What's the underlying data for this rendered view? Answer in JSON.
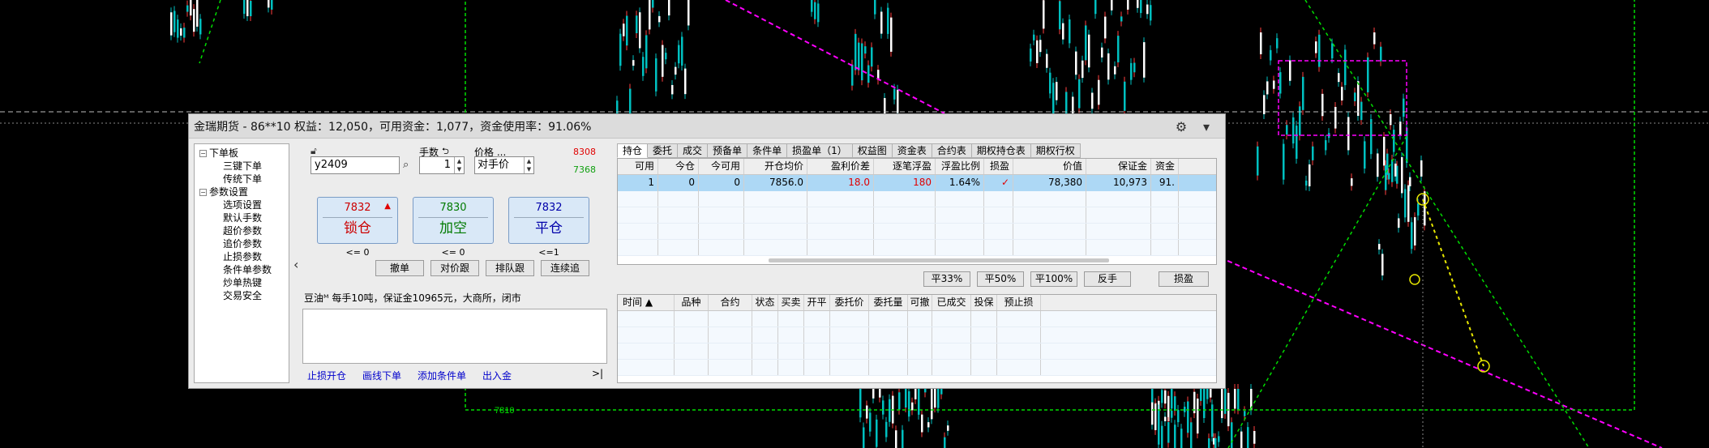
{
  "window": {
    "title": "金瑞期货 - 86**10  权益：12,050，可用资金：1,077，资金使用率：91.06%"
  },
  "tree": {
    "groups": [
      {
        "label": "下单板",
        "items": [
          "三键下单",
          "传统下单"
        ]
      },
      {
        "label": "参数设置",
        "items": [
          "选项设置",
          "默认手数",
          "超价参数",
          "追价参数",
          "止损参数",
          "条件单参数",
          "炒单热键",
          "交易安全"
        ]
      }
    ]
  },
  "order": {
    "contract_value": "y2409",
    "qty_label": "手数",
    "qty_value": "1",
    "price_label": "价格 ...",
    "price_type": "对手价",
    "ask_price": "8308",
    "bid_price": "7368",
    "buttons": [
      {
        "price": "7832",
        "label": "锁仓",
        "avail": "<= 0",
        "color": "#cc0000"
      },
      {
        "price": "7830",
        "label": "加空",
        "avail": "<= 0",
        "color": "#007a00"
      },
      {
        "price": "7832",
        "label": "平仓",
        "avail": "<=1",
        "color": "#0000aa"
      }
    ],
    "up_marker": "▲",
    "small_buttons": [
      "撤单",
      "对价跟",
      "排队跟",
      "连续追"
    ],
    "info": "豆油ᴹ  每手10吨，保证金10965元，大商所，闭市",
    "links": [
      "止损开仓",
      "画线下单",
      "添加条件单",
      "出入金"
    ],
    "more": ">|"
  },
  "tabs": [
    "持仓",
    "委托",
    "成交",
    "预备单",
    "条件单",
    "损盈单（1）",
    "权益图",
    "资金表",
    "合约表",
    "期权持仓表",
    "期权行权"
  ],
  "positions": {
    "columns": [
      "可用",
      "今仓",
      "今可用",
      "开仓均价",
      "盈利价差",
      "逐笔浮盈",
      "浮盈比例",
      "损盈",
      "价值",
      "保证金",
      "资金"
    ],
    "rows": [
      [
        "1",
        "0",
        "0",
        "7856.0",
        "18.0",
        "180",
        "1.64%",
        "✓",
        "78,380",
        "10,973",
        "91."
      ]
    ]
  },
  "actions": [
    "平33%",
    "平50%",
    "平100%",
    "反手",
    "损盈"
  ],
  "orders": {
    "columns": [
      "时间 ▲",
      "品种",
      "合约",
      "状态",
      "买卖",
      "开平",
      "委托价",
      "委托量",
      "可撤",
      "已成交",
      "投保",
      "预止损"
    ]
  },
  "chart": {
    "bottom_price_label": "7810"
  },
  "colors": {
    "bg": "#000000",
    "candle_green": "#00c0c0",
    "trendline": "#00dd00",
    "magenta": "#ff00ff",
    "yellow": "#e6e600"
  }
}
